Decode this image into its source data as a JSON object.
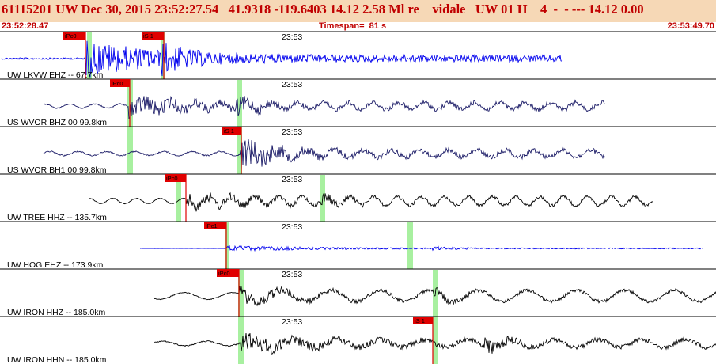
{
  "header": {
    "title": "61115201 UW Dec 30, 2015 23:52:27.54   41.9318 -119.6403 14.12 2.58 Ml re    vidale   UW 01 H    4  -  - --- 14.12 0.00",
    "start_time": "23:52:28.47",
    "timespan": "Timespan=  81 s",
    "end_time": "23:53:49.70"
  },
  "colors": {
    "header_bg": "#f6d8b6",
    "header_text": "#c00000",
    "pick_box": "#e00000",
    "green_marker": "#a8f0a0",
    "blue_trace": "#0000ee",
    "navy_trace": "#1a1a66",
    "black_trace": "#000000"
  },
  "traces": [
    {
      "label": "UW LKVW EHZ --  67.7km",
      "time_label": "23:53",
      "color": "blue",
      "picks": [
        {
          "label": "iPc0"
        },
        {
          "label": "iS 1"
        }
      ]
    },
    {
      "label": "US WVOR BHZ 00  99.8km",
      "time_label": "23:53",
      "color": "navy",
      "picks": [
        {
          "label": "iPc0"
        }
      ]
    },
    {
      "label": "US WVOR BH1 00  99.8km",
      "time_label": "23:53",
      "color": "navy",
      "picks": [
        {
          "label": "iS 1"
        }
      ]
    },
    {
      "label": "UW TREE HHZ --  135.7km",
      "time_label": "23:53",
      "color": "black",
      "picks": [
        {
          "label": "iPc0"
        }
      ]
    },
    {
      "label": "UW HOG EHZ --  173.9km",
      "time_label": "23:53",
      "color": "blue",
      "picks": [
        {
          "label": "iPc1"
        }
      ]
    },
    {
      "label": "UW IRON HHZ --  185.0km",
      "time_label": "23:53",
      "color": "black",
      "picks": [
        {
          "label": "iPc0"
        }
      ]
    },
    {
      "label": "UW IRON HHN --  185.0km",
      "time_label": "23:53",
      "color": "black",
      "picks": [
        {
          "label": "iS 1"
        }
      ]
    }
  ]
}
